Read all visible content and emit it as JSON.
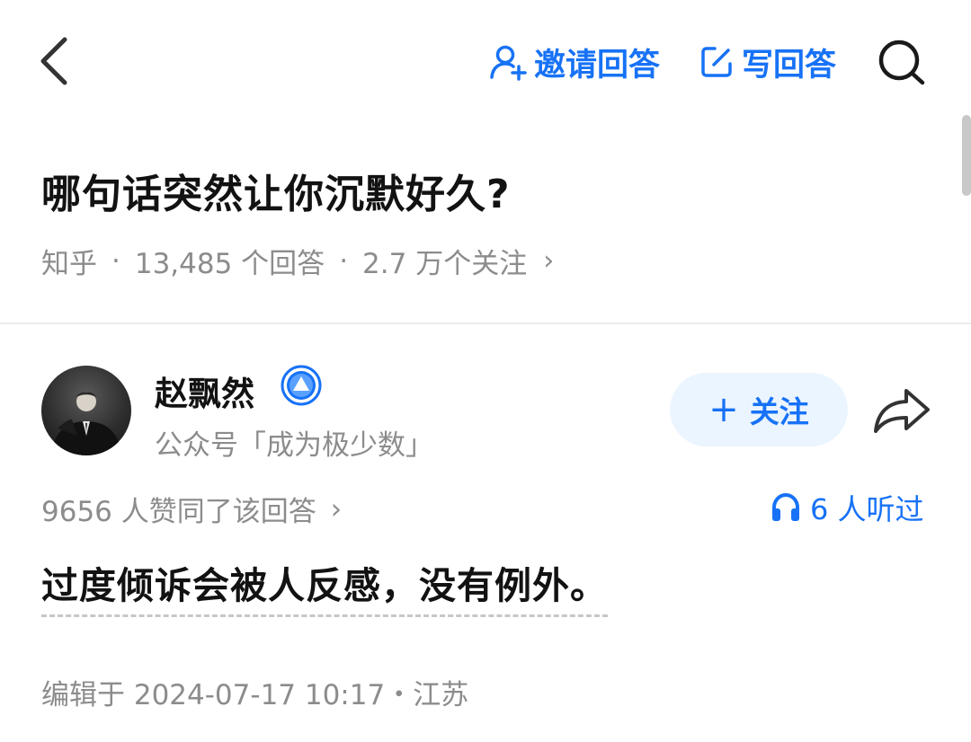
{
  "header": {
    "invite_label": "邀请回答",
    "write_label": "写回答"
  },
  "question": {
    "title": "哪句话突然让你沉默好久?",
    "meta": {
      "source": "知乎",
      "separator": "·",
      "answers": "13,485 个回答",
      "followers": "2.7 万个关注",
      "chevron": "›"
    }
  },
  "answer": {
    "author": {
      "name": "赵飘然",
      "subtitle": "公众号「成为极少数」"
    },
    "follow_label": "关注",
    "follow_plus": "+",
    "votes": "9656 人赞同了该回答",
    "votes_chevron": "›",
    "listen": "6 人听过",
    "content": "过度倾诉会被人反感，没有例外。",
    "edit_info": "编辑于 2024-07-17 10:17・江苏"
  },
  "icons": {
    "back": "chevron-left-icon",
    "invite": "user-plus-icon",
    "write": "edit-icon",
    "search": "search-icon",
    "verified": "verified-badge-icon",
    "share": "share-icon",
    "listen": "headphones-icon"
  },
  "colors": {
    "accent": "#1772f6",
    "follow_bg": "#ebf5ff",
    "muted_text": "#8c8c8c",
    "title_text": "#121212",
    "divider": "#ececec"
  }
}
